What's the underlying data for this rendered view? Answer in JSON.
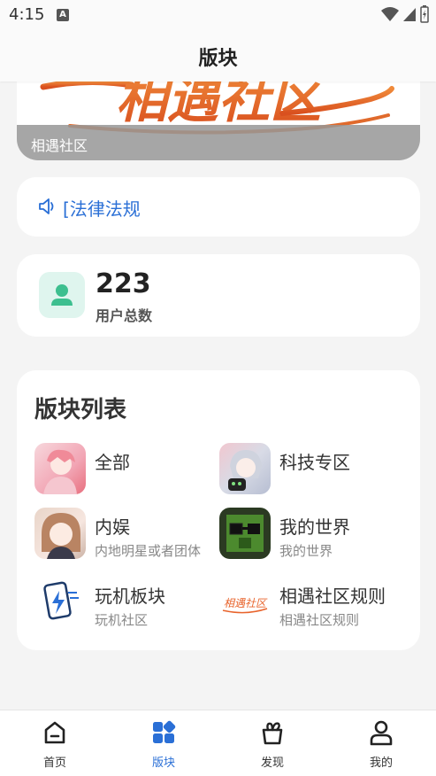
{
  "status": {
    "time": "4:15",
    "notif_icon": "A"
  },
  "header": {
    "title": "版块"
  },
  "banner": {
    "logo_text": "相遇社区",
    "caption": "相遇社区"
  },
  "notice": {
    "text": "[法律法规",
    "icon": "speaker-icon"
  },
  "stats": {
    "count": "223",
    "label": "用户总数"
  },
  "boards": {
    "title": "版块列表",
    "items": [
      {
        "name": "全部",
        "desc": ""
      },
      {
        "name": "科技专区",
        "desc": ""
      },
      {
        "name": "内娱",
        "desc": "内地明星或者团体"
      },
      {
        "name": "我的世界",
        "desc": "我的世界"
      },
      {
        "name": "玩机板块",
        "desc": "玩机社区"
      },
      {
        "name": "相遇社区规则",
        "desc": "相遇社区规则",
        "thumb_text": "相遇社区"
      }
    ]
  },
  "nav": {
    "items": [
      {
        "label": "首页",
        "icon": "home-icon"
      },
      {
        "label": "版块",
        "icon": "boards-icon"
      },
      {
        "label": "发现",
        "icon": "discover-icon"
      },
      {
        "label": "我的",
        "icon": "profile-icon"
      }
    ]
  },
  "colors": {
    "accent": "#2a6fd6",
    "brand_orange": "#e8632b",
    "stats_bg": "#dff5ee",
    "stats_fg": "#3dbf8f"
  }
}
